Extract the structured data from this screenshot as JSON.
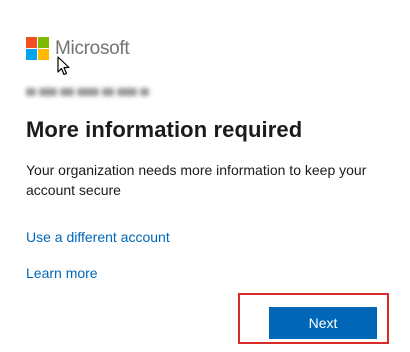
{
  "brand": {
    "name": "Microsoft",
    "logo_colors": [
      "#f25022",
      "#7fba00",
      "#00a4ef",
      "#ffb900"
    ]
  },
  "account": {
    "email": "redacted@example.com"
  },
  "main": {
    "title": "More information required",
    "description": "Your organization needs more information to keep your account secure"
  },
  "links": {
    "use_different_account": "Use a different account",
    "learn_more": "Learn more"
  },
  "actions": {
    "next_label": "Next",
    "highlight_color": "#d92b2b",
    "accent_color": "#0067b8"
  }
}
